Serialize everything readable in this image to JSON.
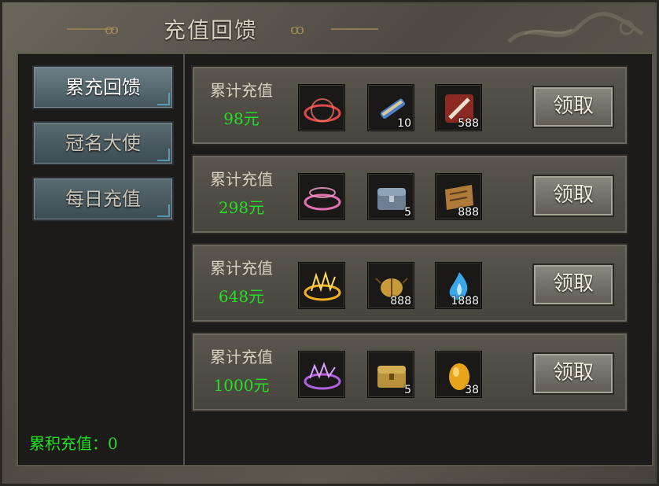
{
  "title": "充值回馈",
  "sidebar": {
    "items": [
      {
        "label": "累充回馈",
        "active": true
      },
      {
        "label": "冠名大使",
        "active": false
      },
      {
        "label": "每日充值",
        "active": false
      }
    ],
    "total_label": "累积充值：0"
  },
  "rows": [
    {
      "label": "累计充值",
      "amount": "98元",
      "effect_color": "#e04a4a",
      "items": [
        {
          "icon": "scroll-icon",
          "count": "10"
        },
        {
          "icon": "sword-charm-icon",
          "count": "588"
        }
      ],
      "claim": "领取"
    },
    {
      "label": "累计充值",
      "amount": "298元",
      "effect_color": "#e070b0",
      "items": [
        {
          "icon": "chest-icon",
          "count": "5"
        },
        {
          "icon": "map-icon",
          "count": "888"
        }
      ],
      "claim": "领取"
    },
    {
      "label": "累计充值",
      "amount": "648元",
      "effect_color": "#f0b020",
      "items": [
        {
          "icon": "beetle-icon",
          "count": "888"
        },
        {
          "icon": "blue-flame-icon",
          "count": "1888"
        }
      ],
      "claim": "领取"
    },
    {
      "label": "累计充值",
      "amount": "1000元",
      "effect_color": "#b060e0",
      "items": [
        {
          "icon": "treasure-chest-icon",
          "count": "5"
        },
        {
          "icon": "golden-egg-icon",
          "count": "38"
        }
      ],
      "claim": "领取"
    }
  ]
}
